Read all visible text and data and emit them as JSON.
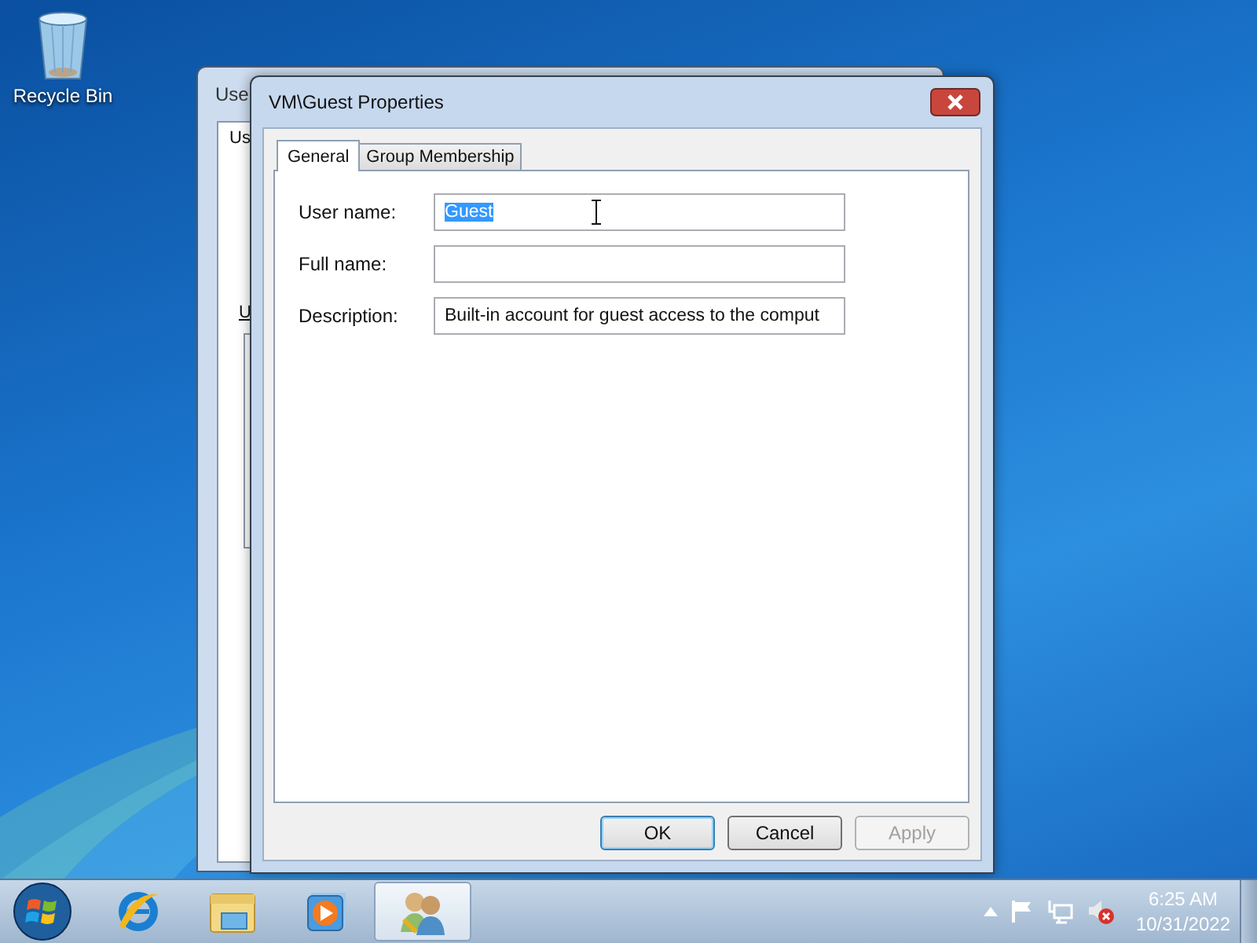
{
  "desktop": {
    "icons": [
      {
        "kind": "recycle-bin",
        "label": "Recycle Bin"
      }
    ]
  },
  "background_window": {
    "title": "Use",
    "tab": "Us",
    "label": "U"
  },
  "dialog": {
    "title": "VM\\Guest Properties",
    "tabs": [
      {
        "label": "General",
        "selected": true
      },
      {
        "label": "Group Membership",
        "selected": false
      }
    ],
    "fields": [
      {
        "label": "User name:",
        "value": "Guest",
        "text_selected": true
      },
      {
        "label": "Full name:"
      },
      {
        "label": "Description:",
        "value": "Built-in account for guest access to the comput"
      }
    ],
    "buttons": [
      {
        "label": "OK",
        "default": true,
        "disabled": false
      },
      {
        "label": "Cancel",
        "default": false,
        "disabled": false
      },
      {
        "label": "Apply",
        "default": false,
        "disabled": true
      }
    ]
  },
  "taskbar": {
    "items": [
      {
        "kind": "browser",
        "active": false
      },
      {
        "kind": "folder",
        "active": false
      },
      {
        "kind": "media",
        "active": false
      },
      {
        "kind": "users",
        "active": true
      }
    ],
    "clock": {
      "time": "6:25 AM",
      "date": "10/31/2022"
    }
  }
}
